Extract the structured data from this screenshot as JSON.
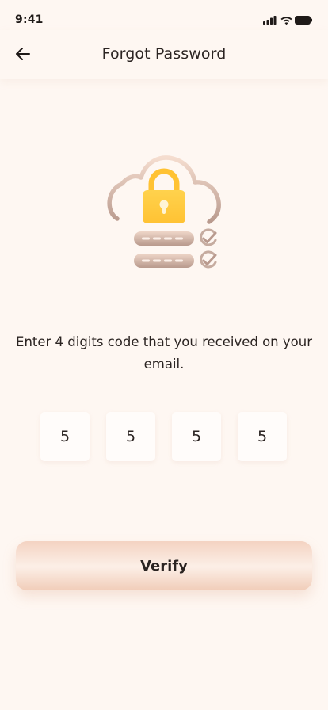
{
  "status_bar": {
    "time": "9:41"
  },
  "header": {
    "title": "Forgot Password"
  },
  "instructions": {
    "text": "Enter 4 digits code  that you received on your email."
  },
  "otp": {
    "digits": [
      "5",
      "5",
      "5",
      "5"
    ]
  },
  "verify": {
    "label": "Verify"
  },
  "colors": {
    "background": "#FEF7F2",
    "accent": "#F4D3C2",
    "lock": "#FFC93E"
  }
}
